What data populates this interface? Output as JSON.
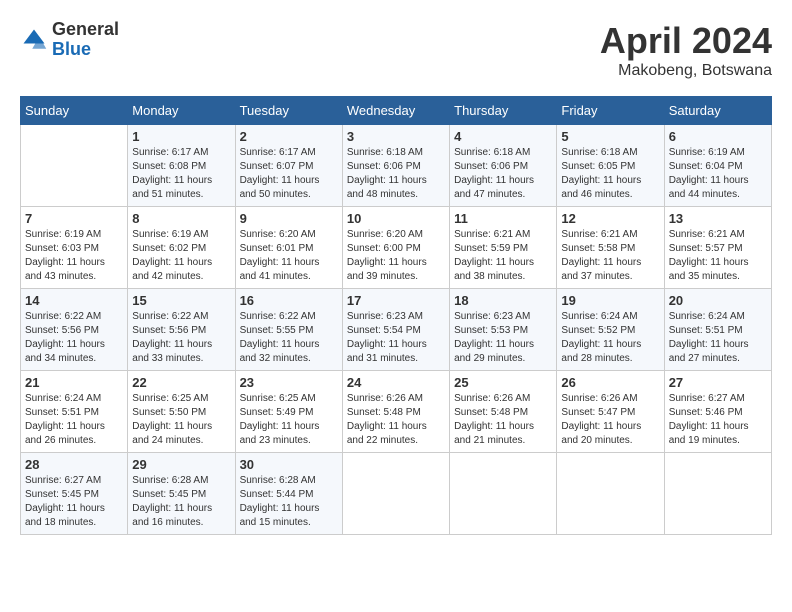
{
  "header": {
    "logo": {
      "general": "General",
      "blue": "Blue"
    },
    "title": "April 2024",
    "location": "Makobeng, Botswana"
  },
  "calendar": {
    "days_of_week": [
      "Sunday",
      "Monday",
      "Tuesday",
      "Wednesday",
      "Thursday",
      "Friday",
      "Saturday"
    ],
    "weeks": [
      [
        {
          "day": "",
          "info": ""
        },
        {
          "day": "1",
          "info": "Sunrise: 6:17 AM\nSunset: 6:08 PM\nDaylight: 11 hours\nand 51 minutes."
        },
        {
          "day": "2",
          "info": "Sunrise: 6:17 AM\nSunset: 6:07 PM\nDaylight: 11 hours\nand 50 minutes."
        },
        {
          "day": "3",
          "info": "Sunrise: 6:18 AM\nSunset: 6:06 PM\nDaylight: 11 hours\nand 48 minutes."
        },
        {
          "day": "4",
          "info": "Sunrise: 6:18 AM\nSunset: 6:06 PM\nDaylight: 11 hours\nand 47 minutes."
        },
        {
          "day": "5",
          "info": "Sunrise: 6:18 AM\nSunset: 6:05 PM\nDaylight: 11 hours\nand 46 minutes."
        },
        {
          "day": "6",
          "info": "Sunrise: 6:19 AM\nSunset: 6:04 PM\nDaylight: 11 hours\nand 44 minutes."
        }
      ],
      [
        {
          "day": "7",
          "info": "Sunrise: 6:19 AM\nSunset: 6:03 PM\nDaylight: 11 hours\nand 43 minutes."
        },
        {
          "day": "8",
          "info": "Sunrise: 6:19 AM\nSunset: 6:02 PM\nDaylight: 11 hours\nand 42 minutes."
        },
        {
          "day": "9",
          "info": "Sunrise: 6:20 AM\nSunset: 6:01 PM\nDaylight: 11 hours\nand 41 minutes."
        },
        {
          "day": "10",
          "info": "Sunrise: 6:20 AM\nSunset: 6:00 PM\nDaylight: 11 hours\nand 39 minutes."
        },
        {
          "day": "11",
          "info": "Sunrise: 6:21 AM\nSunset: 5:59 PM\nDaylight: 11 hours\nand 38 minutes."
        },
        {
          "day": "12",
          "info": "Sunrise: 6:21 AM\nSunset: 5:58 PM\nDaylight: 11 hours\nand 37 minutes."
        },
        {
          "day": "13",
          "info": "Sunrise: 6:21 AM\nSunset: 5:57 PM\nDaylight: 11 hours\nand 35 minutes."
        }
      ],
      [
        {
          "day": "14",
          "info": "Sunrise: 6:22 AM\nSunset: 5:56 PM\nDaylight: 11 hours\nand 34 minutes."
        },
        {
          "day": "15",
          "info": "Sunrise: 6:22 AM\nSunset: 5:56 PM\nDaylight: 11 hours\nand 33 minutes."
        },
        {
          "day": "16",
          "info": "Sunrise: 6:22 AM\nSunset: 5:55 PM\nDaylight: 11 hours\nand 32 minutes."
        },
        {
          "day": "17",
          "info": "Sunrise: 6:23 AM\nSunset: 5:54 PM\nDaylight: 11 hours\nand 31 minutes."
        },
        {
          "day": "18",
          "info": "Sunrise: 6:23 AM\nSunset: 5:53 PM\nDaylight: 11 hours\nand 29 minutes."
        },
        {
          "day": "19",
          "info": "Sunrise: 6:24 AM\nSunset: 5:52 PM\nDaylight: 11 hours\nand 28 minutes."
        },
        {
          "day": "20",
          "info": "Sunrise: 6:24 AM\nSunset: 5:51 PM\nDaylight: 11 hours\nand 27 minutes."
        }
      ],
      [
        {
          "day": "21",
          "info": "Sunrise: 6:24 AM\nSunset: 5:51 PM\nDaylight: 11 hours\nand 26 minutes."
        },
        {
          "day": "22",
          "info": "Sunrise: 6:25 AM\nSunset: 5:50 PM\nDaylight: 11 hours\nand 24 minutes."
        },
        {
          "day": "23",
          "info": "Sunrise: 6:25 AM\nSunset: 5:49 PM\nDaylight: 11 hours\nand 23 minutes."
        },
        {
          "day": "24",
          "info": "Sunrise: 6:26 AM\nSunset: 5:48 PM\nDaylight: 11 hours\nand 22 minutes."
        },
        {
          "day": "25",
          "info": "Sunrise: 6:26 AM\nSunset: 5:48 PM\nDaylight: 11 hours\nand 21 minutes."
        },
        {
          "day": "26",
          "info": "Sunrise: 6:26 AM\nSunset: 5:47 PM\nDaylight: 11 hours\nand 20 minutes."
        },
        {
          "day": "27",
          "info": "Sunrise: 6:27 AM\nSunset: 5:46 PM\nDaylight: 11 hours\nand 19 minutes."
        }
      ],
      [
        {
          "day": "28",
          "info": "Sunrise: 6:27 AM\nSunset: 5:45 PM\nDaylight: 11 hours\nand 18 minutes."
        },
        {
          "day": "29",
          "info": "Sunrise: 6:28 AM\nSunset: 5:45 PM\nDaylight: 11 hours\nand 16 minutes."
        },
        {
          "day": "30",
          "info": "Sunrise: 6:28 AM\nSunset: 5:44 PM\nDaylight: 11 hours\nand 15 minutes."
        },
        {
          "day": "",
          "info": ""
        },
        {
          "day": "",
          "info": ""
        },
        {
          "day": "",
          "info": ""
        },
        {
          "day": "",
          "info": ""
        }
      ]
    ]
  }
}
